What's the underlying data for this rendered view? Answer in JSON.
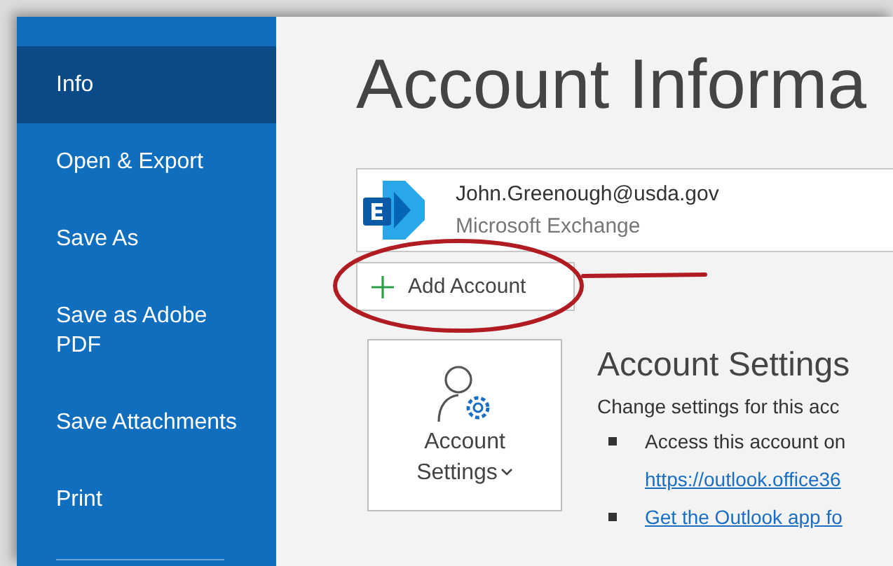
{
  "sidebar": {
    "items": [
      {
        "label": "Info",
        "selected": true
      },
      {
        "label": "Open & Export",
        "selected": false
      },
      {
        "label": "Save As",
        "selected": false
      },
      {
        "label": "Save as Adobe PDF",
        "selected": false
      },
      {
        "label": "Save Attachments",
        "selected": false
      },
      {
        "label": "Print",
        "selected": false
      }
    ]
  },
  "title": "Account Informa",
  "account": {
    "email": "John.Greenough@usda.gov",
    "type": "Microsoft Exchange"
  },
  "add_account_button": "Add Account",
  "account_settings": {
    "tile_label": "Account Settings",
    "heading": "Account Settings",
    "description": "Change settings for this acc",
    "bullets": [
      {
        "parts": [
          {
            "kind": "text",
            "text": "Access this account on"
          },
          {
            "kind": "link",
            "text": "https://outlook.office36"
          }
        ]
      },
      {
        "parts": [
          {
            "kind": "link",
            "text": "Get the Outlook app fo"
          }
        ]
      }
    ]
  }
}
